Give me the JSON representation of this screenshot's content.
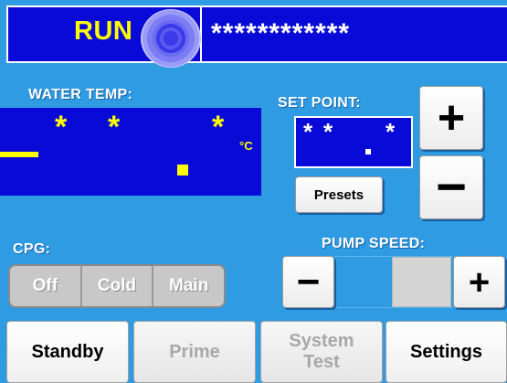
{
  "status": {
    "run_label": "RUN",
    "message": "************"
  },
  "water_temp": {
    "label": "WATER TEMP:",
    "digit_1": "*",
    "digit_2": "*",
    "digit_3": "*",
    "unit": "°C"
  },
  "set_point": {
    "label": "SET POINT:",
    "digit_1": "*",
    "digit_2": "*",
    "digit_3": "*",
    "increase_label": "+",
    "decrease_label": "−",
    "presets_label": "Presets"
  },
  "cpg": {
    "label": "CPG:",
    "options": [
      "Off",
      "Cold",
      "Main"
    ]
  },
  "pump_speed": {
    "label": "PUMP SPEED:",
    "decrease_label": "−",
    "increase_label": "+"
  },
  "nav": {
    "standby": "Standby",
    "prime": "Prime",
    "system_test_line1": "System",
    "system_test_line2": "Test",
    "settings": "Settings"
  },
  "colors": {
    "background": "#2e9be3",
    "display": "#0a0ad8",
    "value": "#ffff00"
  }
}
